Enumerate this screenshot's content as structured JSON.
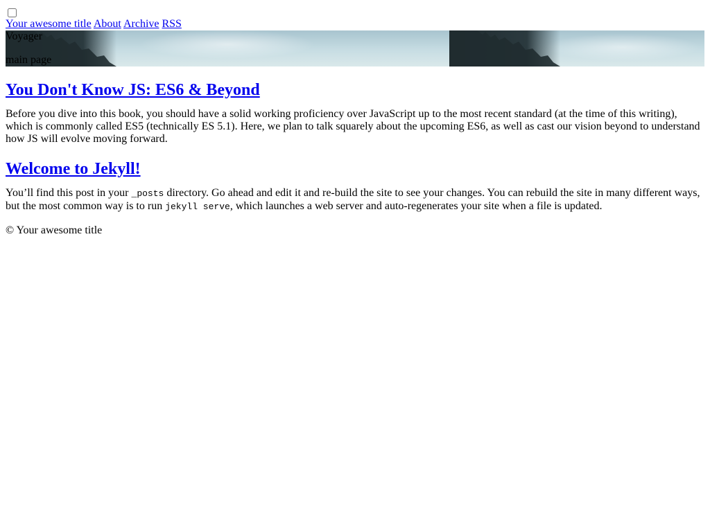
{
  "header": {
    "menu_toggle_checked": false
  },
  "nav": {
    "items": [
      {
        "label": "Your awesome title"
      },
      {
        "label": "About"
      },
      {
        "label": "Archive"
      },
      {
        "label": "RSS"
      }
    ]
  },
  "hero": {
    "title": "Voyager",
    "subtitle": "main page"
  },
  "posts": [
    {
      "title": "You Don't Know JS: ES6 & Beyond",
      "excerpt": "Before you dive into this book, you should have a solid working proficiency over JavaScript up to the most recent standard (at the time of this writing), which is commonly called ES5 (technically ES 5.1). Here, we plan to talk squarely about the upcoming ES6, as well as cast our vision beyond to understand how JS will evolve moving forward."
    },
    {
      "title": "Welcome to Jekyll!",
      "excerpt_before_code1": "You’ll find this post in your ",
      "code1": "_posts",
      "excerpt_between": " directory. Go ahead and edit it and re-build the site to see your changes. You can rebuild the site in many different ways, but the most common way is to run ",
      "code2": "jekyll serve",
      "excerpt_after_code2": ", which launches a web server and auto-regenerates your site when a file is updated."
    }
  ],
  "footer": {
    "text": "© Your awesome title"
  },
  "colors": {
    "link": "#0000ee",
    "text": "#000000",
    "background": "#ffffff"
  }
}
